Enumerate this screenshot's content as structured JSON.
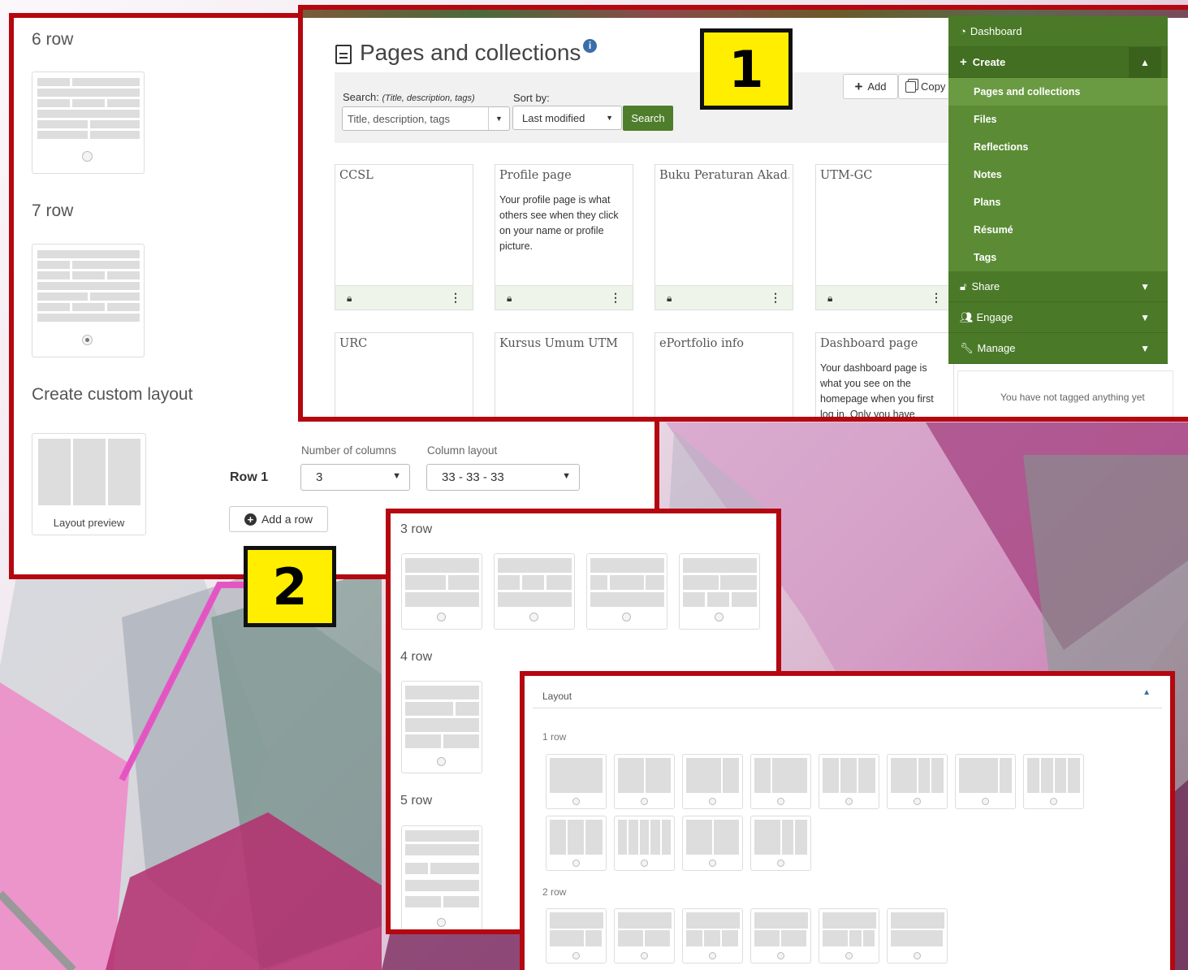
{
  "panel_left": {
    "sections": {
      "row6": "6 row",
      "row7": "7 row",
      "custom": "Create custom layout"
    },
    "layout_preview_label": "Layout preview",
    "row_label": "Row 1",
    "num_columns_label": "Number of columns",
    "num_columns_value": "3",
    "column_layout_label": "Column layout",
    "column_layout_value": "33 - 33 - 33",
    "add_row_label": "Add a row"
  },
  "panel_pages": {
    "title": "Pages and collections",
    "search_label": "Search:",
    "search_hint": "(Title, description, tags)",
    "search_placeholder": "Title, description, tags",
    "sort_label": "Sort by:",
    "sort_value": "Last modified",
    "search_button": "Search",
    "add_button": "Add",
    "copy_button": "Copy",
    "cards": [
      {
        "title": "CCSL",
        "desc": ""
      },
      {
        "title": "Profile page",
        "desc": "Your profile page is what others see when they click on your name or profile picture."
      },
      {
        "title": "Buku Peraturan Akad...",
        "desc": ""
      },
      {
        "title": "UTM-GC",
        "desc": ""
      },
      {
        "title": "URC",
        "desc": ""
      },
      {
        "title": "Kursus Umum UTM",
        "desc": ""
      },
      {
        "title": "ePortfolio info",
        "desc": ""
      },
      {
        "title": "Dashboard page",
        "desc": "Your dashboard page is what you see on the homepage when you first log in. Only you have"
      }
    ],
    "tag_note": "You have not tagged anything yet"
  },
  "nav": {
    "dashboard": "Dashboard",
    "create": "Create",
    "create_items": [
      "Pages and collections",
      "Files",
      "Reflections",
      "Notes",
      "Plans",
      "Résumé",
      "Tags"
    ],
    "share": "Share",
    "engage": "Engage",
    "manage": "Manage"
  },
  "badges": {
    "one": "1",
    "two": "2"
  },
  "panel_rows": {
    "row3": "3 row",
    "row4": "4 row",
    "row5": "5 row"
  },
  "panel_layout": {
    "header": "Layout",
    "row1": "1 row",
    "row2": "2 row"
  },
  "colors": {
    "frame": "#b5070f",
    "nav_green": "#4e7d2b",
    "badge_yellow": "#ffee00",
    "search_green": "#4e7d2b"
  }
}
